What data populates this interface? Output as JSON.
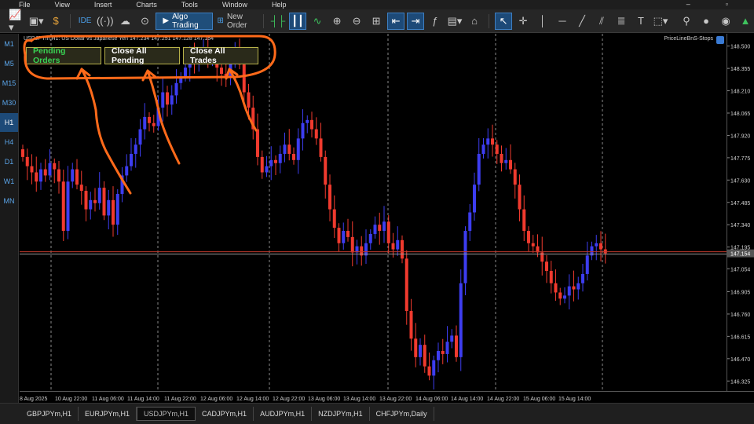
{
  "menu": [
    "File",
    "View",
    "Insert",
    "Charts",
    "Tools",
    "Window",
    "Help"
  ],
  "toolbar": {
    "algo_label": "Algo Trading",
    "new_order_label": "New Order",
    "ide_label": "IDE"
  },
  "timeframes": [
    "M1",
    "M5",
    "M15",
    "M30",
    "H1",
    "H4",
    "D1",
    "W1",
    "MN"
  ],
  "active_timeframe": "H1",
  "chart": {
    "header": "USDJPYm,H1:  US Dollar vs Japanese Yen  147.234 147.251 147.128 147.154",
    "indicator": "PriceLineBnS-Stops",
    "buttons": {
      "pending": "Pending Orders",
      "close_pending": "Close All Pending",
      "close_trades": "Close All Trades"
    },
    "current_price_label": "147.154",
    "bull_color": "#3d3df0",
    "bear_color": "#f03a2e",
    "doji_color": "#2fb84a"
  },
  "chart_data": {
    "type": "candlestick",
    "symbol": "USDJPYm",
    "timeframe": "H1",
    "price_ticks": [
      "148.500",
      "148.355",
      "148.210",
      "148.065",
      "147.920",
      "147.775",
      "147.630",
      "147.485",
      "147.340",
      "147.195",
      "147.054",
      "146.905",
      "146.760",
      "146.615",
      "146.470",
      "146.325"
    ],
    "time_ticks": [
      "8 Aug 2025",
      "10 Aug 22:00",
      "11 Aug 06:00",
      "11 Aug 14:00",
      "11 Aug 22:00",
      "12 Aug 06:00",
      "12 Aug 14:00",
      "12 Aug 22:00",
      "13 Aug 06:00",
      "13 Aug 14:00",
      "13 Aug 22:00",
      "14 Aug 06:00",
      "14 Aug 14:00",
      "14 Aug 22:00",
      "15 Aug 06:00",
      "15 Aug 14:00"
    ],
    "current_price": 147.154,
    "ylim": [
      146.26,
      148.58
    ],
    "closes": [
      147.78,
      147.72,
      147.68,
      147.62,
      147.7,
      147.66,
      147.74,
      147.7,
      147.62,
      147.3,
      147.62,
      147.7,
      147.6,
      147.56,
      147.44,
      147.5,
      147.48,
      147.58,
      147.4,
      147.5,
      147.34,
      147.54,
      147.66,
      147.72,
      147.8,
      147.86,
      147.96,
      148.04,
      148.0,
      147.98,
      148.1,
      148.2,
      148.12,
      148.18,
      148.26,
      148.3,
      148.36,
      148.42,
      148.4,
      148.44,
      148.48,
      148.4,
      148.42,
      148.36,
      148.32,
      148.3,
      148.4,
      148.46,
      148.38,
      148.2,
      148.1,
      147.96,
      147.78,
      147.68,
      147.72,
      147.76,
      147.74,
      147.8,
      147.86,
      147.8,
      147.76,
      147.9,
      148.0,
      148.02,
      147.96,
      147.9,
      147.78,
      147.6,
      147.44,
      147.32,
      147.22,
      147.3,
      147.26,
      147.16,
      147.2,
      147.14,
      147.22,
      147.28,
      147.34,
      147.3,
      147.36,
      147.22,
      147.18,
      147.24,
      147.12,
      146.78,
      146.6,
      146.48,
      146.56,
      146.42,
      146.36,
      146.46,
      146.52,
      146.5,
      146.58,
      146.62,
      146.48,
      146.96,
      147.3,
      147.42,
      147.6,
      147.8,
      147.86,
      147.9,
      147.86,
      147.8,
      147.74,
      147.76,
      147.7,
      147.6,
      147.44,
      147.3,
      147.22,
      147.2,
      147.16,
      147.1,
      147.04,
      146.96,
      146.9,
      146.86,
      146.88,
      146.94,
      146.92,
      146.96,
      147.02,
      147.14,
      147.2,
      147.22,
      147.18,
      147.154
    ]
  }
}
